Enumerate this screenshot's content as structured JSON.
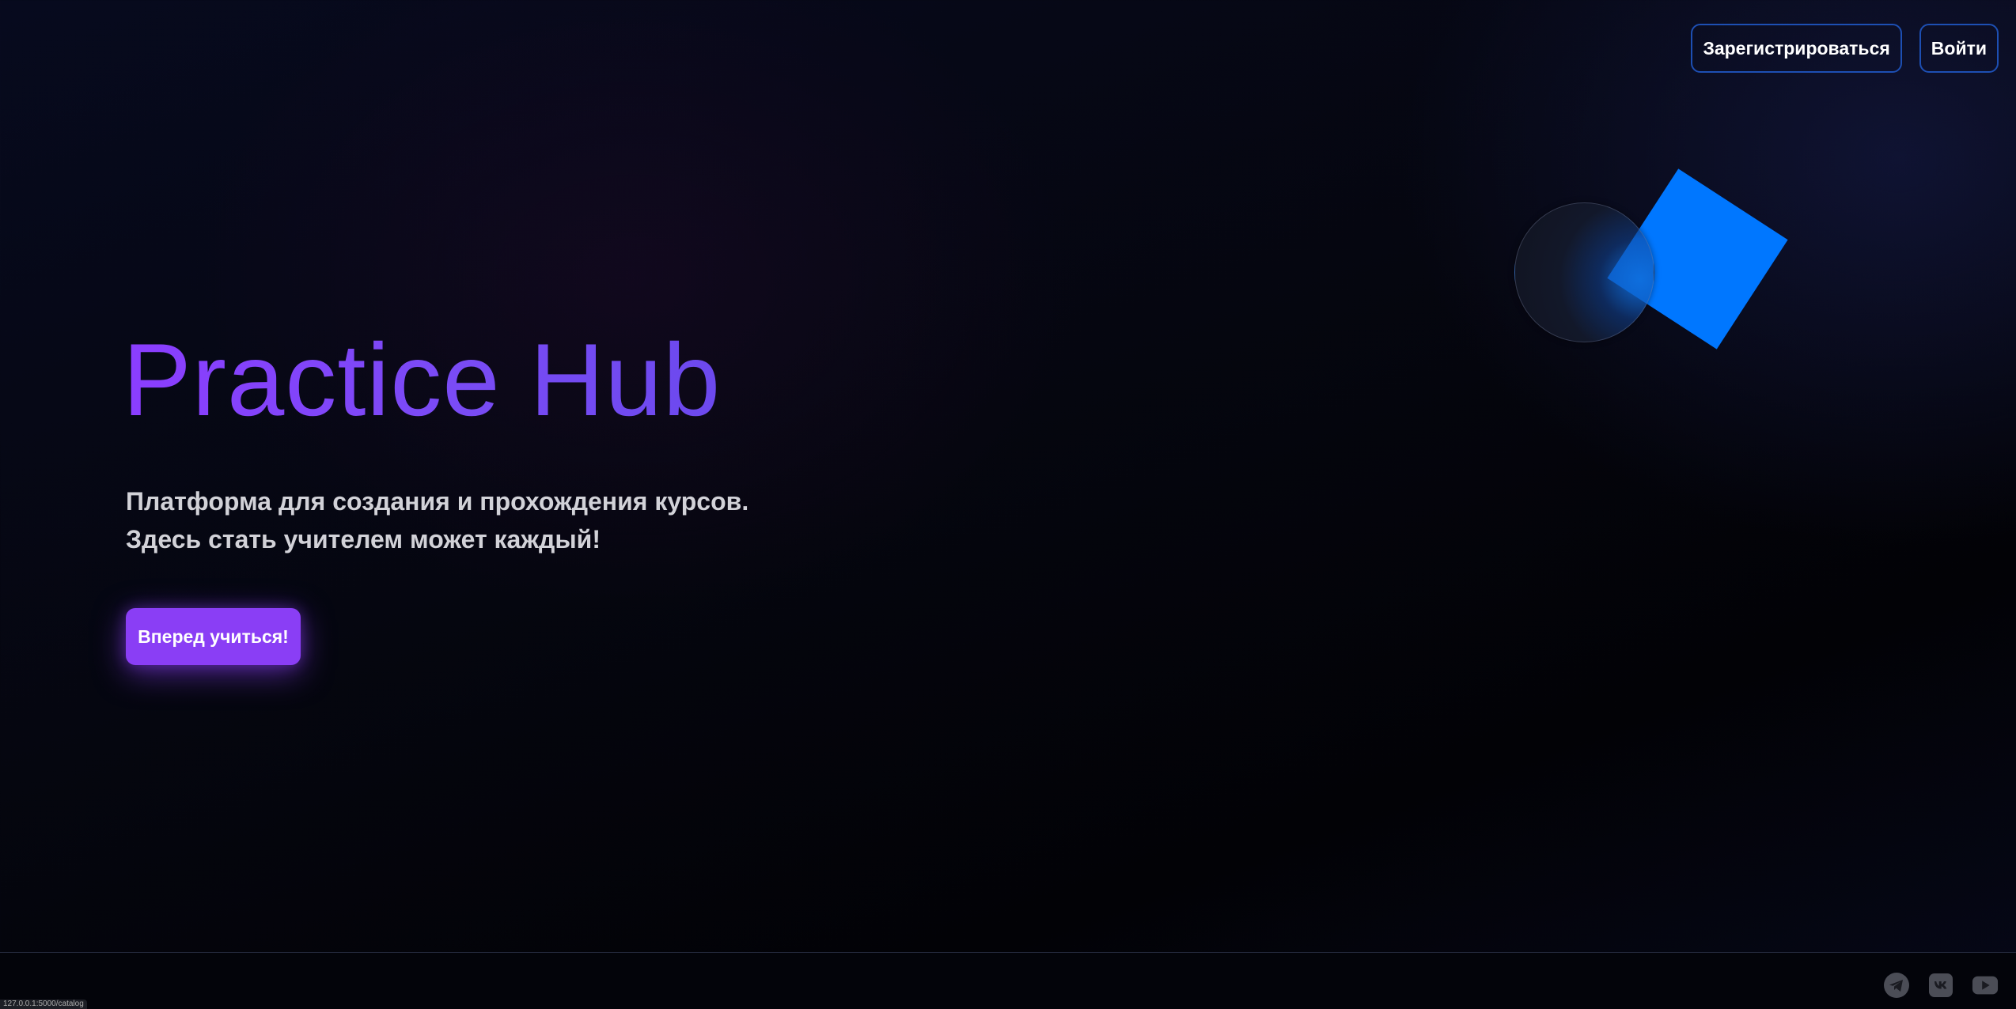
{
  "header": {
    "register_label": "Зарегистрироваться",
    "login_label": "Войти"
  },
  "hero": {
    "title": "Practice Hub",
    "subtitle_line1": "Платформа для создания и прохождения курсов.",
    "subtitle_line2": "Здесь стать учителем может каждый!",
    "cta_label": "Вперед учиться!"
  },
  "footer": {
    "socials": [
      {
        "name": "telegram",
        "icon": "telegram-icon"
      },
      {
        "name": "vk",
        "icon": "vk-icon"
      },
      {
        "name": "youtube",
        "icon": "youtube-icon"
      }
    ]
  },
  "status_bar": {
    "url": "127.0.0.1:5000/catalog"
  },
  "colors": {
    "accent_purple": "#8a3ef5",
    "accent_blue": "#0077ff",
    "outline_blue": "#1d4fb3",
    "background": "#05060f"
  }
}
